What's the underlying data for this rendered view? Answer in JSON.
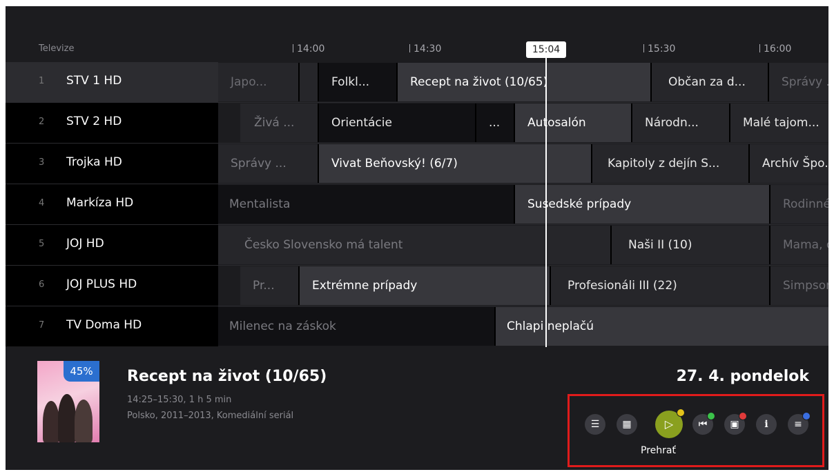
{
  "header": {
    "label": "Televize",
    "times": [
      "14:00",
      "14:30",
      "15:30",
      "16:00"
    ],
    "now": "15:04"
  },
  "channels": [
    {
      "num": "1",
      "name": "STV 1 HD"
    },
    {
      "num": "2",
      "name": "STV 2 HD"
    },
    {
      "num": "3",
      "name": "Trojka HD"
    },
    {
      "num": "4",
      "name": "Markíza HD"
    },
    {
      "num": "5",
      "name": "JOJ HD"
    },
    {
      "num": "6",
      "name": "JOJ PLUS HD"
    },
    {
      "num": "7",
      "name": "TV Doma HD"
    }
  ],
  "programs": [
    [
      "Japo...",
      "",
      "Folkl...",
      "Recept na život (10/65)",
      "Občan za d...",
      "Správy ..."
    ],
    [
      "Živá ...",
      "Orientácie",
      "...",
      "Autosalón",
      "Národn...",
      "Malé tajom..."
    ],
    [
      "Správy ...",
      "Vivat Beňovský! (6/7)",
      "Kapitoly z dejín S...",
      "Archív Špo..."
    ],
    [
      "Mentalista",
      "Susedské prípady",
      "Rodinné..."
    ],
    [
      "Česko Slovensko má talent",
      "Naši II (10)",
      "Mama, c..."
    ],
    [
      "Pr...",
      "Extrémne prípady",
      "Profesionáli III (22)",
      "Simpsono..."
    ],
    [
      "Milenec na záskok",
      "Chlapi neplačú"
    ]
  ],
  "selected": {
    "progress": "45%",
    "title": "Recept na život (10/65)",
    "time": "14:25–15:30, 1 h 5 min",
    "meta": "Polsko, 2011–2013, Komediální seriál",
    "date": "27. 4. pondelok"
  },
  "controls": {
    "icons": [
      "list-icon",
      "calendar-icon",
      "play-icon",
      "restart-icon",
      "record-icon",
      "info-icon",
      "menu-icon"
    ],
    "play_label": "Prehrať",
    "dot_colors": {
      "yellow": "#e2c21a",
      "green": "#3bc24a",
      "red": "#e03a3a",
      "blue": "#3a6ee0"
    }
  }
}
